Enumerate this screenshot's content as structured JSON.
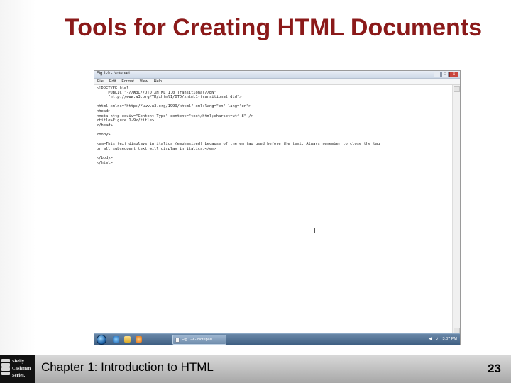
{
  "slide": {
    "title": "Tools for Creating HTML Documents",
    "footer": "Chapter 1: Introduction to HTML",
    "page_number": "23",
    "logo_text": [
      "Shelly",
      "Cashman",
      "Series."
    ]
  },
  "notepad": {
    "window_title": "Fig 1-9 - Notepad",
    "menu": [
      "File",
      "Edit",
      "Format",
      "View",
      "Help"
    ],
    "window_buttons": [
      "–",
      "□",
      "x"
    ],
    "code_lines": [
      "<!DOCTYPE html",
      "     PUBLIC \"-//W3C//DTD XHTML 1.0 Transitional//EN\"",
      "     \"http://www.w3.org/TR/xhtml1/DTD/xhtml1-transitional.dtd\">",
      "",
      "<html xmlns=\"http://www.w3.org/1999/xhtml\" xml:lang=\"en\" lang=\"en\">",
      "<head>",
      "<meta http-equiv=\"Content-Type\" content=\"text/html;charset=utf-8\" />",
      "<title>Figure 1-9</title>",
      "</head>",
      "",
      "<body>",
      "",
      "<em>This text displays in italics (emphasized) because of the em tag used before the text. Always remember to close the tag",
      "or all subsequent text will display in italics.</em>",
      "",
      "</body>",
      "</html>"
    ]
  },
  "taskbar": {
    "task_label": "Fig 1-9 - Notepad",
    "tray_icons": [
      "◀",
      "♪"
    ],
    "time": "3:07 PM"
  },
  "colors": {
    "title": "#8b1a1a",
    "taskbar": "#4f6f92"
  }
}
